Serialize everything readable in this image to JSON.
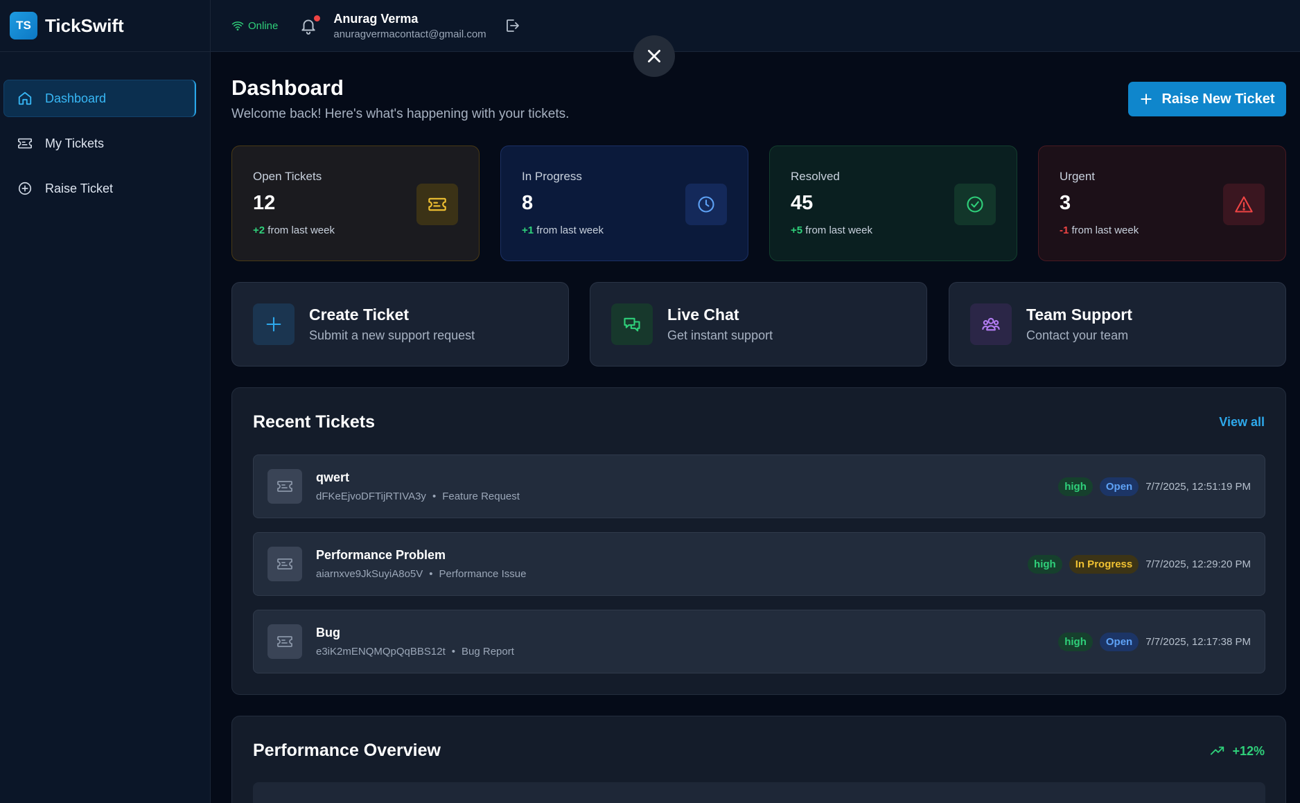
{
  "brand": {
    "logo_text": "TS",
    "name": "TickSwift"
  },
  "sidebar": {
    "items": [
      {
        "label": "Dashboard",
        "icon": "home-icon",
        "active": true
      },
      {
        "label": "My Tickets",
        "icon": "ticket-icon"
      },
      {
        "label": "Raise Ticket",
        "icon": "plus-circle-icon"
      }
    ]
  },
  "header": {
    "status": "Online",
    "user_name": "Anurag Verma",
    "user_email": "anuragvermacontact@gmail.com"
  },
  "page": {
    "title": "Dashboard",
    "subtitle": "Welcome back! Here's what's happening with your tickets.",
    "raise_button": "Raise New Ticket"
  },
  "stats": [
    {
      "label": "Open Tickets",
      "value": "12",
      "delta": "+2",
      "delta_text": " from last week",
      "color": "#f1c232"
    },
    {
      "label": "In Progress",
      "value": "8",
      "delta": "+1",
      "delta_text": " from last week",
      "color": "#5ea2f6"
    },
    {
      "label": "Resolved",
      "value": "45",
      "delta": "+5",
      "delta_text": " from last week",
      "color": "#2fd07a"
    },
    {
      "label": "Urgent",
      "value": "3",
      "delta": "-1",
      "delta_text": " from last week",
      "color": "#ef4444"
    }
  ],
  "actions": [
    {
      "title": "Create Ticket",
      "subtitle": "Submit a new support request"
    },
    {
      "title": "Live Chat",
      "subtitle": "Get instant support"
    },
    {
      "title": "Team Support",
      "subtitle": "Contact your team"
    }
  ],
  "recent": {
    "title": "Recent Tickets",
    "view_all": "View all",
    "tickets": [
      {
        "title": "qwert",
        "id": "dFKeEjvoDFTijRTIVA3y",
        "category": "Feature Request",
        "priority": "high",
        "status": "Open",
        "date": "7/7/2025, 12:51:19 PM"
      },
      {
        "title": "Performance Problem",
        "id": "aiarnxve9JkSuyiA8o5V",
        "category": "Performance Issue",
        "priority": "high",
        "status": "In Progress",
        "date": "7/7/2025, 12:29:20 PM"
      },
      {
        "title": "Bug",
        "id": "e3iK2mENQMQpQqBBS12t",
        "category": "Bug Report",
        "priority": "high",
        "status": "Open",
        "date": "7/7/2025, 12:17:38 PM"
      }
    ]
  },
  "performance": {
    "title": "Performance Overview",
    "trend": "+12%"
  },
  "colors": {
    "accent": "#0f86cc",
    "background": "#050b18",
    "success": "#2fd07a",
    "danger": "#ef4444"
  }
}
